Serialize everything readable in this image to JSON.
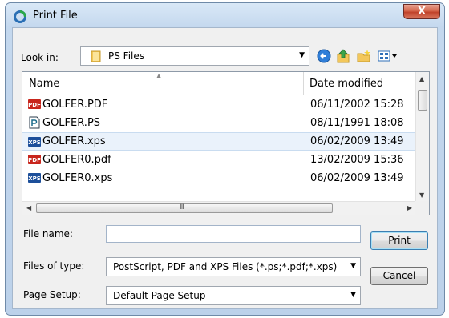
{
  "window": {
    "title": "Print File",
    "close_label": "X"
  },
  "toolbar": {
    "look_in_label": "Look in:",
    "look_in_value": "PS Files",
    "icons": [
      "back-icon",
      "up-folder-icon",
      "new-folder-icon",
      "view-menu-icon"
    ]
  },
  "file_list": {
    "columns": {
      "name": "Name",
      "date": "Date modified"
    },
    "rows": [
      {
        "name": "GOLFER.PDF",
        "date": "06/11/2002 15:28",
        "icon": "pdf-file-icon"
      },
      {
        "name": "GOLFER.PS",
        "date": "08/11/1991 18:08",
        "icon": "ps-file-icon"
      },
      {
        "name": "GOLFER.xps",
        "date": "06/02/2009 13:49",
        "icon": "xps-file-icon",
        "selected": true
      },
      {
        "name": "GOLFER0.pdf",
        "date": "13/02/2009 15:36",
        "icon": "pdf-file-icon"
      },
      {
        "name": "GOLFER0.xps",
        "date": "06/02/2009 13:49",
        "icon": "xps-file-icon"
      }
    ]
  },
  "form": {
    "file_name_label": "File name:",
    "file_name_value": "",
    "file_types_label": "Files of type:",
    "file_types_value": "PostScript, PDF and XPS Files (*.ps;*.pdf;*.xps)",
    "page_setup_label": "Page Setup:",
    "page_setup_value": "Default Page Setup"
  },
  "buttons": {
    "print": "Print",
    "cancel": "Cancel"
  },
  "colors": {
    "pdf": "#c8261d",
    "xps": "#1d4f9a",
    "selection": "#eaf2fb",
    "close": "#c8452d"
  }
}
